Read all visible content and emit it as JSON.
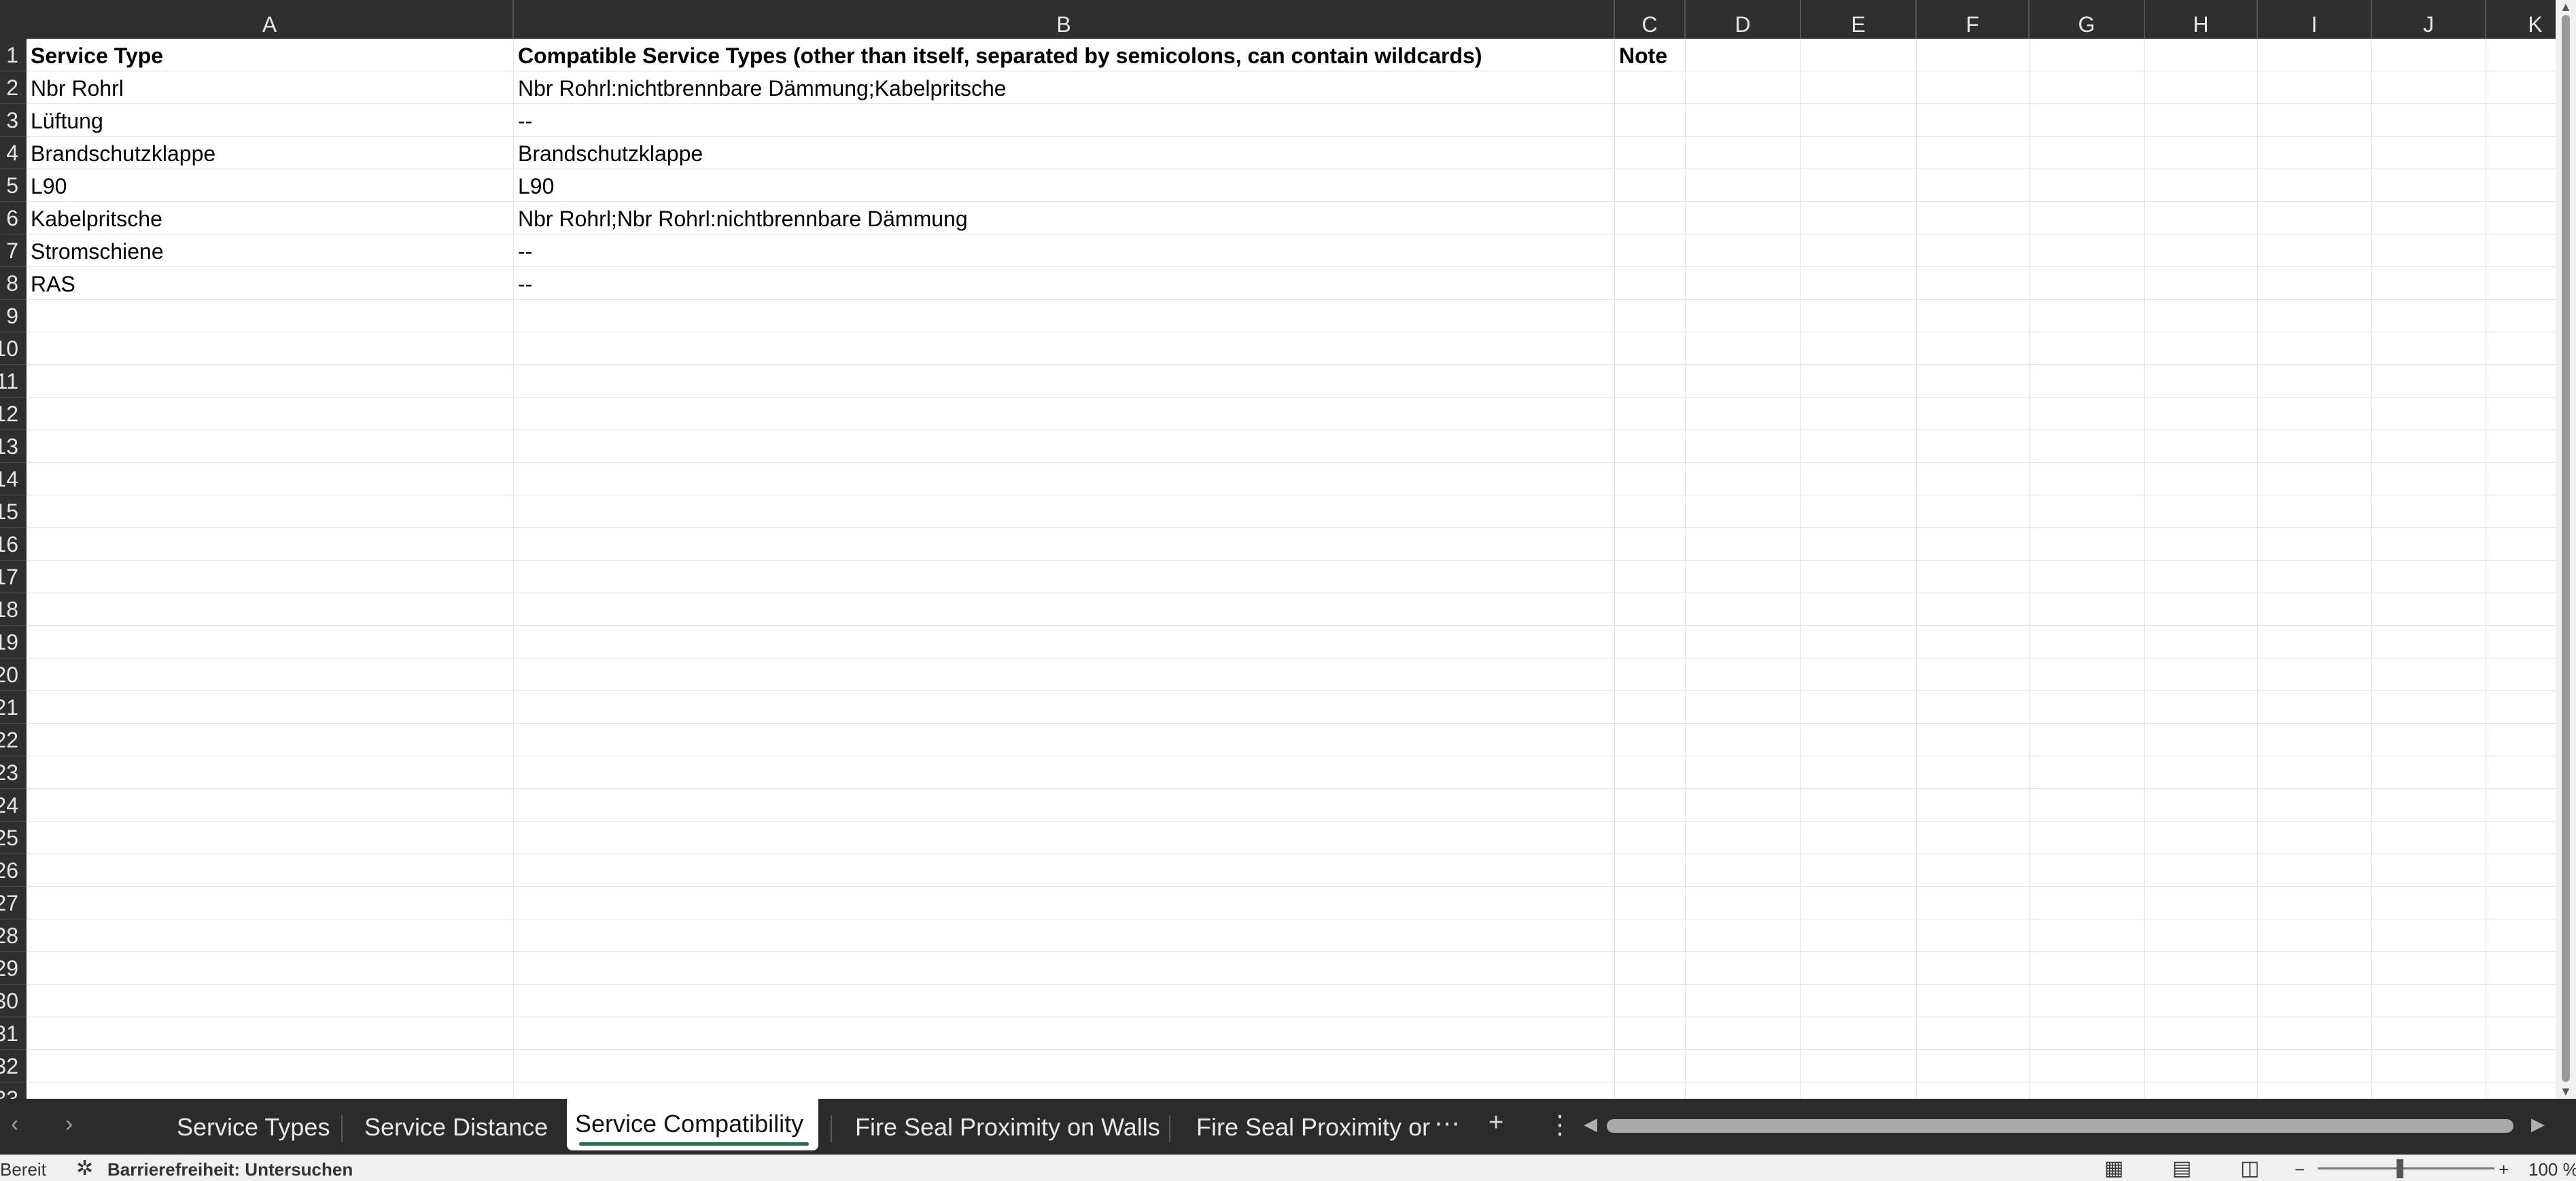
{
  "columns": [
    "A",
    "B",
    "C",
    "D",
    "E",
    "F",
    "G",
    "H",
    "I",
    "J",
    "K"
  ],
  "rows": [
    "1",
    "2",
    "3",
    "4",
    "5",
    "6",
    "7",
    "8",
    "9",
    "10",
    "11",
    "12",
    "13",
    "14",
    "15",
    "16",
    "17",
    "18",
    "19",
    "20",
    "21",
    "22",
    "23",
    "24",
    "25",
    "26",
    "27",
    "28",
    "29",
    "30",
    "31",
    "32",
    "33"
  ],
  "cells": {
    "A1": "Service Type",
    "B1": "Compatible Service Types (other than itself, separated by semicolons, can contain wildcards)",
    "C1": "Note",
    "A2": "Nbr Rohrl",
    "B2": "Nbr Rohrl:nichtbrennbare Dämmung;Kabelpritsche",
    "A3": "Lüftung",
    "B3": "--",
    "A4": "Brandschutzklappe",
    "B4": "Brandschutzklappe",
    "A5": "L90",
    "B5": "L90",
    "A6": "Kabelpritsche",
    "B6": "Nbr Rohrl;Nbr Rohrl:nichtbrennbare Dämmung",
    "A7": "Stromschiene",
    "B7": "--",
    "A8": "RAS",
    "B8": "--"
  },
  "sheet_tabs": {
    "tab1": "Service Types",
    "tab2": "Service Distance",
    "tab3": "Service Compatibility",
    "tab4": "Fire Seal Proximity on Walls",
    "tab5": "Fire Seal Proximity or",
    "active": "Service Compatibility"
  },
  "status": {
    "ready": "Bereit",
    "accessibility": "Barrierefreiheit: Untersuchen",
    "zoom": "100 %"
  },
  "icons": {
    "prev_sheet": "chevron-left-icon",
    "next_sheet": "chevron-right-icon",
    "more_tabs": "ellipsis-icon",
    "add_sheet": "plus-icon",
    "options": "vertical-ellipsis-icon",
    "normal_view": "grid-view-icon",
    "page_layout": "page-layout-icon",
    "page_break": "page-break-icon"
  },
  "colors": {
    "header_bg": "#2f2f2f",
    "active_tab_underline": "#1e7145",
    "gridline": "#e2e2e2"
  }
}
